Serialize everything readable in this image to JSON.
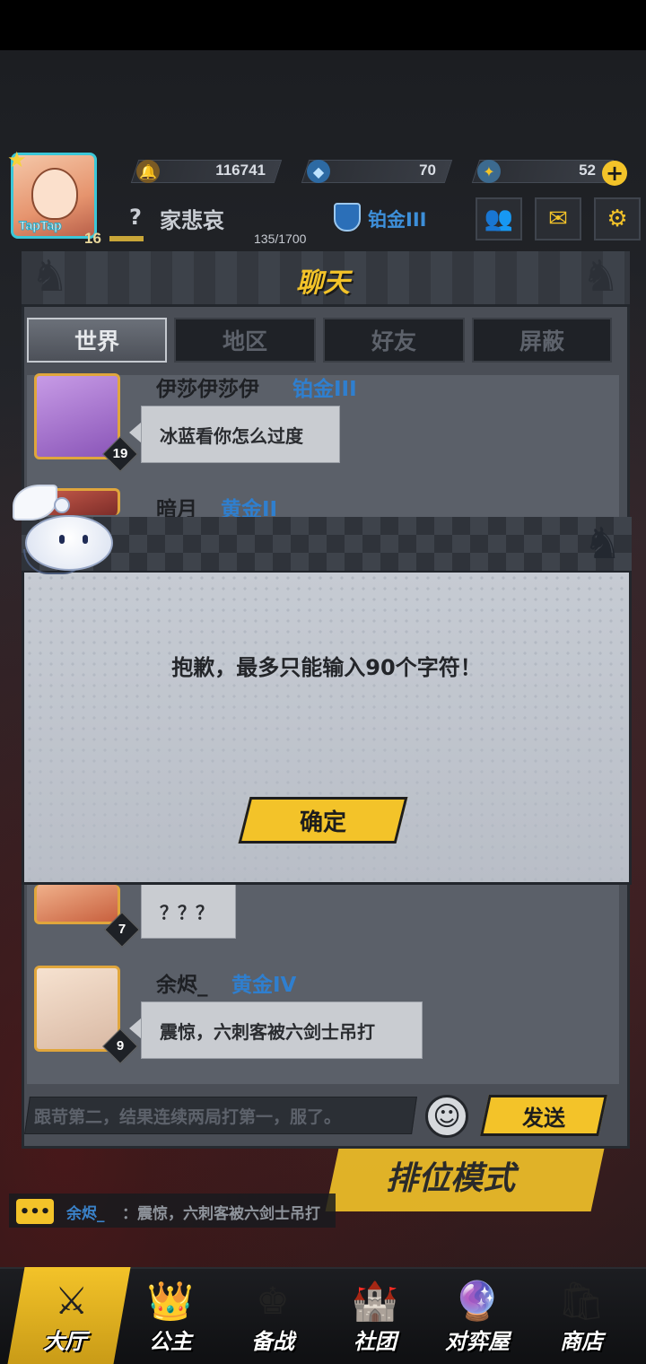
{
  "hud": {
    "avatar_brand": "TapTap",
    "level": "16",
    "currencies": [
      {
        "icon": "bell-coin-icon",
        "value": "116741"
      },
      {
        "icon": "crystal-icon",
        "value": "70"
      },
      {
        "icon": "ticket-icon",
        "value": "52"
      }
    ],
    "plus_label": "+",
    "player_unknown_mark": "?",
    "player_name": "家悲哀",
    "rank": "铂金III",
    "xp": "135/1700"
  },
  "chat": {
    "title": "聊天",
    "tabs": [
      "世界",
      "地区",
      "好友",
      "屏蔽"
    ],
    "active_tab": 0,
    "messages": [
      {
        "name": "伊莎伊莎伊",
        "rank": "铂金III",
        "level": "19",
        "text": "冰蓝看你怎么过度"
      },
      {
        "name": "暗月",
        "rank": "黄金II",
        "level": "",
        "text": ""
      },
      {
        "name": "",
        "rank": "",
        "level": "7",
        "text": "？？？"
      },
      {
        "name": "余烬_",
        "rank": "黄金IV",
        "level": "9",
        "text": "震惊，六刺客被六剑士吊打"
      }
    ],
    "input_text": "跟苛第二，结果连续两局打第一，服了。",
    "send_label": "发送"
  },
  "ticker": {
    "icon_label": "•••",
    "name": "余烬_",
    "text": "：震惊，六刺客被六剑士吊打"
  },
  "rank_mode_label": "排位模式",
  "dialog": {
    "message": "抱歉，最多只能输入90个字符！",
    "confirm_label": "确定"
  },
  "nav": [
    {
      "label": "大厅",
      "icon": "swords-icon",
      "active": true
    },
    {
      "label": "公主",
      "icon": "princess-icon",
      "active": false
    },
    {
      "label": "备战",
      "icon": "chess-icon",
      "active": false
    },
    {
      "label": "社团",
      "icon": "castle-icon",
      "active": false
    },
    {
      "label": "对弈屋",
      "icon": "crystal-ball-icon",
      "active": false
    },
    {
      "label": "商店",
      "icon": "shop-icon",
      "active": false
    }
  ],
  "colors": {
    "accent": "#f3c329",
    "rank_blue": "#2f7fcf",
    "panel": "#4a4e56"
  }
}
